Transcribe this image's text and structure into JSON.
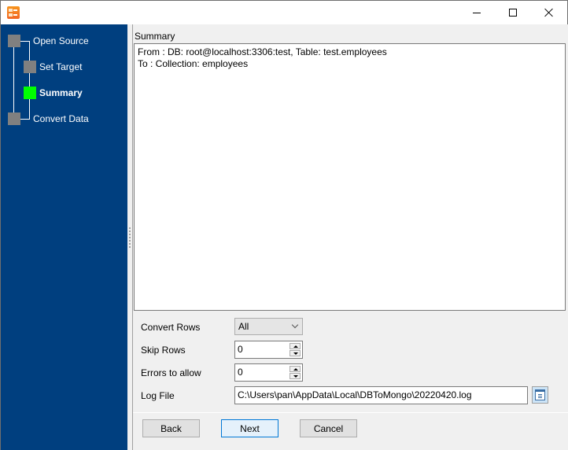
{
  "window": {
    "icon": "app-icon",
    "controls": {
      "minimize": "minimize-icon",
      "maximize": "maximize-icon",
      "close": "close-icon"
    }
  },
  "sidebar": {
    "steps": [
      {
        "label": "Open Source",
        "state": "pending"
      },
      {
        "label": "Set Target",
        "state": "pending"
      },
      {
        "label": "Summary",
        "state": "active"
      },
      {
        "label": "Convert Data",
        "state": "pending"
      }
    ],
    "colors": {
      "background": "#003f7f",
      "active": "#00ff00",
      "inactive": "#808080"
    }
  },
  "summary": {
    "label": "Summary",
    "lines": [
      "From : DB: root@localhost:3306:test, Table: test.employees",
      "To : Collection: employees"
    ]
  },
  "form": {
    "convert_rows": {
      "label": "Convert Rows",
      "value": "All"
    },
    "skip_rows": {
      "label": "Skip Rows",
      "value": "0"
    },
    "errors_to_allow": {
      "label": "Errors to allow",
      "value": "0"
    },
    "log_file": {
      "label": "Log File",
      "value": "C:\\Users\\pan\\AppData\\Local\\DBToMongo\\20220420.log"
    }
  },
  "buttons": {
    "back": "Back",
    "next": "Next",
    "cancel": "Cancel"
  }
}
